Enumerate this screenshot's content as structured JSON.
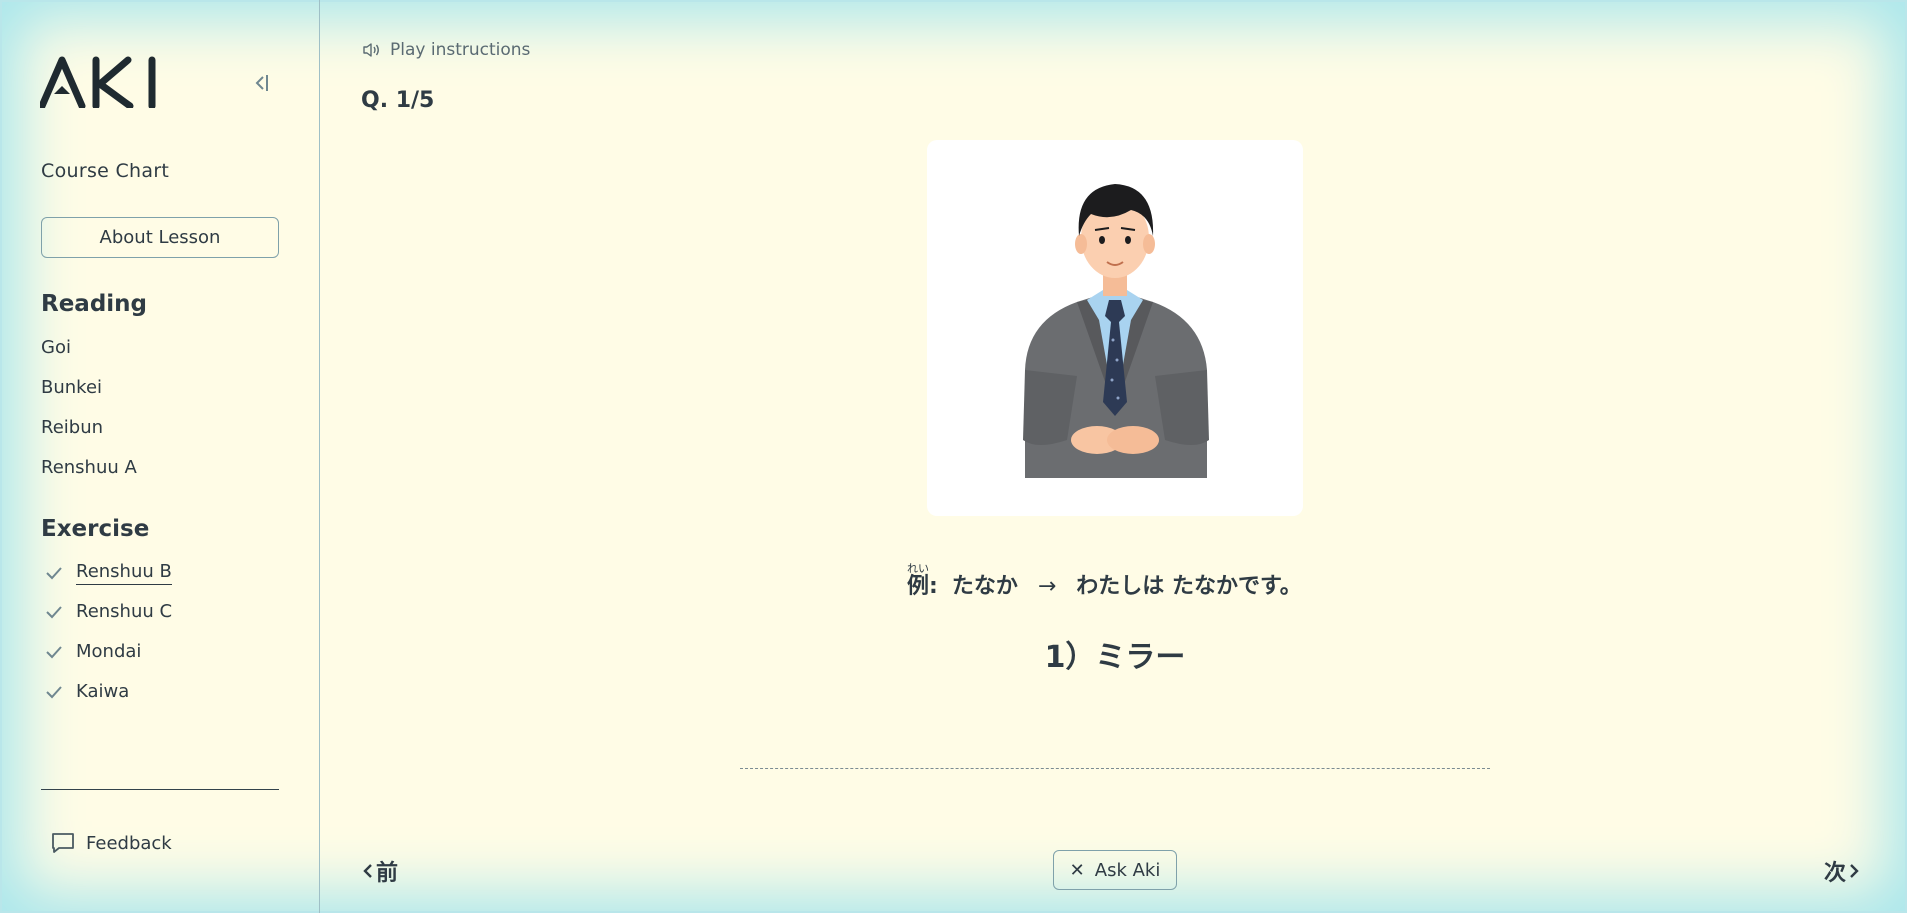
{
  "app": {
    "logo_text": "AKI"
  },
  "sidebar": {
    "course_chart": "Course Chart",
    "about_lesson": "About Lesson",
    "reading_heading": "Reading",
    "reading_items": [
      "Goi",
      "Bunkei",
      "Reibun",
      "Renshuu A"
    ],
    "exercise_heading": "Exercise",
    "exercise_items": [
      {
        "label": "Renshuu B",
        "done": true,
        "active": true
      },
      {
        "label": "Renshuu C",
        "done": true,
        "active": false
      },
      {
        "label": "Mondai",
        "done": true,
        "active": false
      },
      {
        "label": "Kaiwa",
        "done": true,
        "active": false
      }
    ],
    "feedback": "Feedback"
  },
  "main": {
    "play_instructions": "Play instructions",
    "question_number": "Q. 1/5",
    "example": {
      "kanji": "例",
      "furigana": "れい",
      "colon": ":",
      "prompt": "たなか",
      "arrow": "→",
      "answer": "わたしは たなかです。"
    },
    "question": "1）ミラー",
    "prev_label": "前",
    "next_label": "次",
    "ask_label": "Ask Aki"
  },
  "colors": {
    "background": "#fffce6",
    "edge_glow": "#a9e6ec",
    "text": "#2f3b44",
    "muted": "#5a6a72"
  }
}
